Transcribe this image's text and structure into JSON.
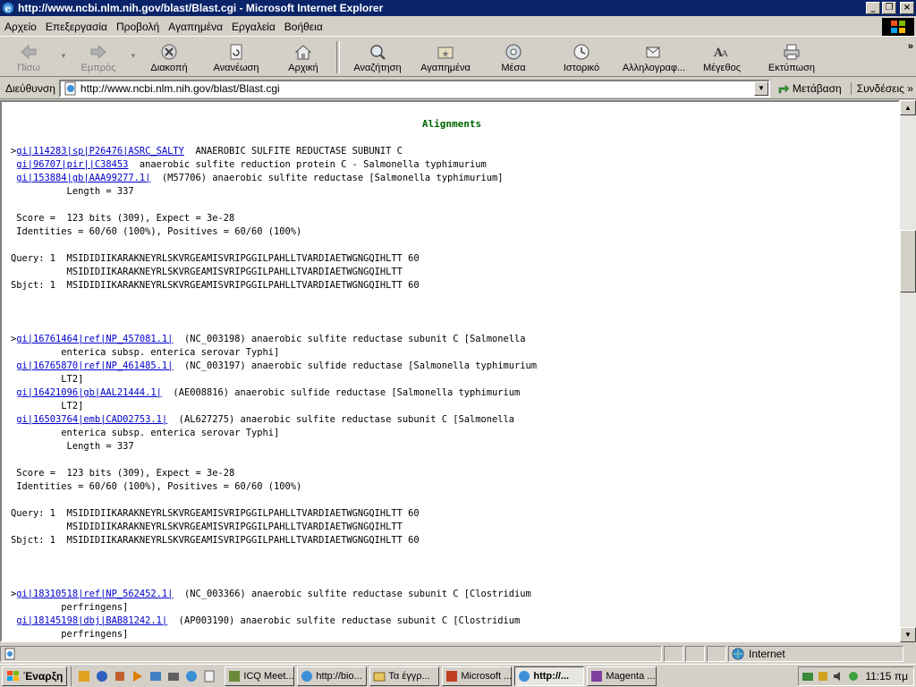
{
  "window": {
    "title": "http://www.ncbi.nlm.nih.gov/blast/Blast.cgi - Microsoft Internet Explorer"
  },
  "menu": [
    "Αρχείο",
    "Επεξεργασία",
    "Προβολή",
    "Αγαπημένα",
    "Εργαλεία",
    "Βοήθεια"
  ],
  "toolbar": {
    "back": "Πίσω",
    "forward": "Εμπρός",
    "stop": "Διακοπή",
    "refresh": "Ανανέωση",
    "home": "Αρχική",
    "search": "Αναζήτηση",
    "favorites": "Αγαπημένα",
    "media": "Μέσα",
    "history": "Ιστορικό",
    "mail": "Αλληλογραφ...",
    "size": "Μέγεθος",
    "print": "Εκτύπωση"
  },
  "address": {
    "label": "Διεύθυνση",
    "value": "http://www.ncbi.nlm.nih.gov/blast/Blast.cgi",
    "go": "Μετάβαση",
    "links": "Συνδέσεις"
  },
  "content": {
    "title": "Alignments",
    "alignments": [
      {
        "hits": [
          {
            "prefix": ">",
            "id": "gi|114283|sp|P26476|ASRC_SALTY",
            "desc": "  ANAEROBIC SULFITE REDUCTASE SUBUNIT C"
          },
          {
            "prefix": " ",
            "id": "gi|96707|pir||C38453",
            "desc": "  anaerobic sulfite reduction protein C - Salmonella typhimurium"
          },
          {
            "prefix": " ",
            "id": "gi|153884|gb|AAA99277.1|",
            "desc": "  (M57706) anaerobic sulfite reductase [Salmonella typhimurium]"
          }
        ],
        "length": "          Length = 337",
        "score": " Score =  123 bits (309), Expect = 3e-28",
        "identities": " Identities = 60/60 (100%), Positives = 60/60 (100%)",
        "query": "Query: 1  MSIDIDIIKARAKNEYRLSKVRGEAMISVRIPGGILPAHLLTVARDIAETWGNGQIHLTT 60",
        "middle": "          MSIDIDIIKARAKNEYRLSKVRGEAMISVRIPGGILPAHLLTVARDIAETWGNGQIHLTT",
        "sbjct": "Sbjct: 1  MSIDIDIIKARAKNEYRLSKVRGEAMISVRIPGGILPAHLLTVARDIAETWGNGQIHLTT 60"
      },
      {
        "hits": [
          {
            "prefix": ">",
            "id": "gi|16761464|ref|NP_457081.1|",
            "desc": "  (NC_003198) anaerobic sulfite reductase subunit C [Salmonella",
            "cont": "         enterica subsp. enterica serovar Typhi]"
          },
          {
            "prefix": " ",
            "id": "gi|16765870|ref|NP_461485.1|",
            "desc": "  (NC_003197) anaerobic sulfide reductase [Salmonella typhimurium",
            "cont": "         LT2]"
          },
          {
            "prefix": " ",
            "id": "gi|16421096|gb|AAL21444.1|",
            "desc": "  (AE008816) anaerobic sulfide reductase [Salmonella typhimurium",
            "cont": "         LT2]"
          },
          {
            "prefix": " ",
            "id": "gi|16503764|emb|CAD02753.1|",
            "desc": "  (AL627275) anaerobic sulfite reductase subunit C [Salmonella",
            "cont": "         enterica subsp. enterica serovar Typhi]"
          }
        ],
        "length": "          Length = 337",
        "score": " Score =  123 bits (309), Expect = 3e-28",
        "identities": " Identities = 60/60 (100%), Positives = 60/60 (100%)",
        "query": "Query: 1  MSIDIDIIKARAKNEYRLSKVRGEAMISVRIPGGILPAHLLTVARDIAETWGNGQIHLTT 60",
        "middle": "          MSIDIDIIKARAKNEYRLSKVRGEAMISVRIPGGILPAHLLTVARDIAETWGNGQIHLTT",
        "sbjct": "Sbjct: 1  MSIDIDIIKARAKNEYRLSKVRGEAMISVRIPGGILPAHLLTVARDIAETWGNGQIHLTT 60"
      },
      {
        "hits": [
          {
            "prefix": ">",
            "id": "gi|18310518|ref|NP_562452.1|",
            "desc": "  (NC_003366) anaerobic sulfite reductase subunit C [Clostridium",
            "cont": "         perfringens]"
          },
          {
            "prefix": " ",
            "id": "gi|18145198|dbj|BAB81242.1|",
            "desc": "  (AP003190) anaerobic sulfite reductase subunit C [Clostridium",
            "cont": "         perfringens]"
          }
        ]
      }
    ]
  },
  "status": {
    "zone": "Internet"
  },
  "taskbar": {
    "start": "Έναρξη",
    "tasks": [
      "ICQ Meet...",
      "http://bio...",
      "Τα έγγρ...",
      "Microsoft ...",
      "http://...",
      "Magenta ..."
    ],
    "clock": "11:15 πμ"
  }
}
